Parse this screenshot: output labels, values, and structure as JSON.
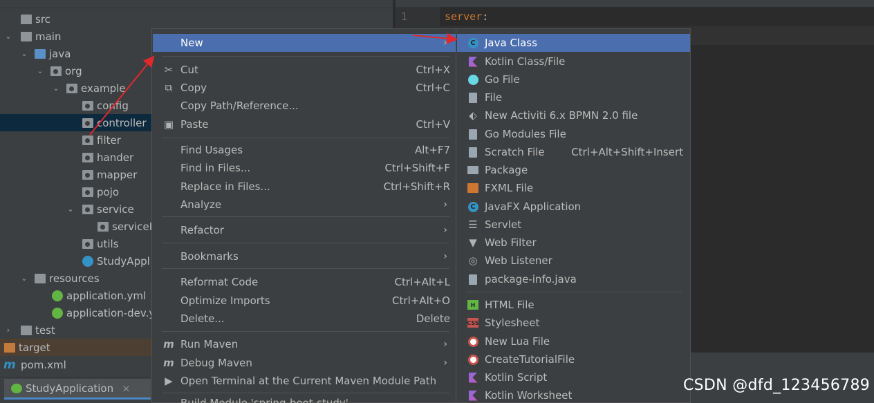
{
  "tree": {
    "rows": [
      {
        "label": "src",
        "icon": "folder-icon"
      },
      {
        "label": "main",
        "icon": "folder-icon"
      },
      {
        "label": "java",
        "icon": "source-folder-icon"
      },
      {
        "label": "org",
        "icon": "package-icon"
      },
      {
        "label": "example",
        "icon": "package-icon"
      },
      {
        "label": "config",
        "icon": "package-icon"
      },
      {
        "label": "controller",
        "icon": "package-icon"
      },
      {
        "label": "filter",
        "icon": "package-icon"
      },
      {
        "label": "hander",
        "icon": "package-icon"
      },
      {
        "label": "mapper",
        "icon": "package-icon"
      },
      {
        "label": "pojo",
        "icon": "package-icon"
      },
      {
        "label": "service",
        "icon": "package-icon"
      },
      {
        "label": "serviceI",
        "icon": "package-icon"
      },
      {
        "label": "utils",
        "icon": "package-icon"
      },
      {
        "label": "StudyAppl",
        "icon": "spring-boot-class-icon"
      },
      {
        "label": "resources",
        "icon": "resources-folder-icon"
      },
      {
        "label": "application.yml",
        "icon": "spring-config-icon"
      },
      {
        "label": "application-dev.y",
        "icon": "spring-config-icon"
      },
      {
        "label": "test",
        "icon": "folder-icon"
      },
      {
        "label": "target",
        "icon": "excluded-folder-icon"
      },
      {
        "label": "pom.xml",
        "icon": "maven-icon"
      }
    ]
  },
  "run_tab": {
    "label": "StudyApplication",
    "close": "×"
  },
  "editor": {
    "line_number": "1",
    "code_key": "server",
    "code_colon": ":"
  },
  "context_menu": {
    "items": [
      {
        "label": "New",
        "shortcut": "",
        "submenu": true,
        "icon": ""
      },
      {
        "label": "Cut",
        "shortcut": "Ctrl+X",
        "icon": "scissors-icon"
      },
      {
        "label": "Copy",
        "shortcut": "Ctrl+C",
        "icon": "copy-icon"
      },
      {
        "label": "Copy Path/Reference...",
        "shortcut": "",
        "icon": ""
      },
      {
        "label": "Paste",
        "shortcut": "Ctrl+V",
        "icon": "clipboard-icon"
      },
      {
        "label": "Find Usages",
        "shortcut": "Alt+F7",
        "icon": ""
      },
      {
        "label": "Find in Files...",
        "shortcut": "Ctrl+Shift+F",
        "icon": ""
      },
      {
        "label": "Replace in Files...",
        "shortcut": "Ctrl+Shift+R",
        "icon": ""
      },
      {
        "label": "Analyze",
        "shortcut": "",
        "submenu": true,
        "icon": ""
      },
      {
        "label": "Refactor",
        "shortcut": "",
        "submenu": true,
        "icon": ""
      },
      {
        "label": "Bookmarks",
        "shortcut": "",
        "submenu": true,
        "icon": ""
      },
      {
        "label": "Reformat Code",
        "shortcut": "Ctrl+Alt+L",
        "icon": ""
      },
      {
        "label": "Optimize Imports",
        "shortcut": "Ctrl+Alt+O",
        "icon": ""
      },
      {
        "label": "Delete...",
        "shortcut": "Delete",
        "icon": ""
      },
      {
        "label": "Run Maven",
        "shortcut": "",
        "submenu": true,
        "icon": "maven-run-icon"
      },
      {
        "label": "Debug Maven",
        "shortcut": "",
        "submenu": true,
        "icon": "maven-debug-icon"
      },
      {
        "label": "Open Terminal at the Current Maven Module Path",
        "shortcut": "",
        "icon": "terminal-icon"
      },
      {
        "label": "Build Module 'spring-boot-study'",
        "shortcut": "",
        "icon": ""
      }
    ]
  },
  "new_submenu": {
    "items": [
      {
        "label": "Java Class",
        "shortcut": "",
        "icon": "java-class-icon"
      },
      {
        "label": "Kotlin Class/File",
        "shortcut": "",
        "icon": "kotlin-file-icon"
      },
      {
        "label": "Go File",
        "shortcut": "",
        "icon": "go-file-icon"
      },
      {
        "label": "File",
        "shortcut": "",
        "icon": "file-icon"
      },
      {
        "label": "New Activiti 6.x BPMN 2.0 file",
        "shortcut": "",
        "icon": "bpmn-icon"
      },
      {
        "label": "Go Modules File",
        "shortcut": "",
        "icon": "go-modules-icon"
      },
      {
        "label": "Scratch File",
        "shortcut": "Ctrl+Alt+Shift+Insert",
        "icon": "scratch-file-icon"
      },
      {
        "label": "Package",
        "shortcut": "",
        "icon": "package-icon"
      },
      {
        "label": "FXML File",
        "shortcut": "",
        "icon": "fxml-icon"
      },
      {
        "label": "JavaFX Application",
        "shortcut": "",
        "icon": "javafx-icon"
      },
      {
        "label": "Servlet",
        "shortcut": "",
        "icon": "servlet-icon"
      },
      {
        "label": "Web Filter",
        "shortcut": "",
        "icon": "filter-icon"
      },
      {
        "label": "Web Listener",
        "shortcut": "",
        "icon": "listener-icon"
      },
      {
        "label": "package-info.java",
        "shortcut": "",
        "icon": "package-info-icon"
      },
      {
        "label": "HTML File",
        "shortcut": "",
        "icon": "html-icon"
      },
      {
        "label": "Stylesheet",
        "shortcut": "",
        "icon": "css-icon"
      },
      {
        "label": "New Lua File",
        "shortcut": "",
        "icon": "lua-icon"
      },
      {
        "label": "CreateTutorialFile",
        "shortcut": "",
        "icon": "tutorial-icon"
      },
      {
        "label": "Kotlin Script",
        "shortcut": "",
        "icon": "kotlin-script-icon"
      },
      {
        "label": "Kotlin Worksheet",
        "shortcut": "",
        "icon": "kotlin-worksheet-icon"
      }
    ]
  },
  "watermark": "CSDN @dfd_123456789",
  "colors": {
    "selection": "#4b6eaf",
    "annotation_arrow": "#e0282d",
    "code_key": "#cc7832"
  }
}
